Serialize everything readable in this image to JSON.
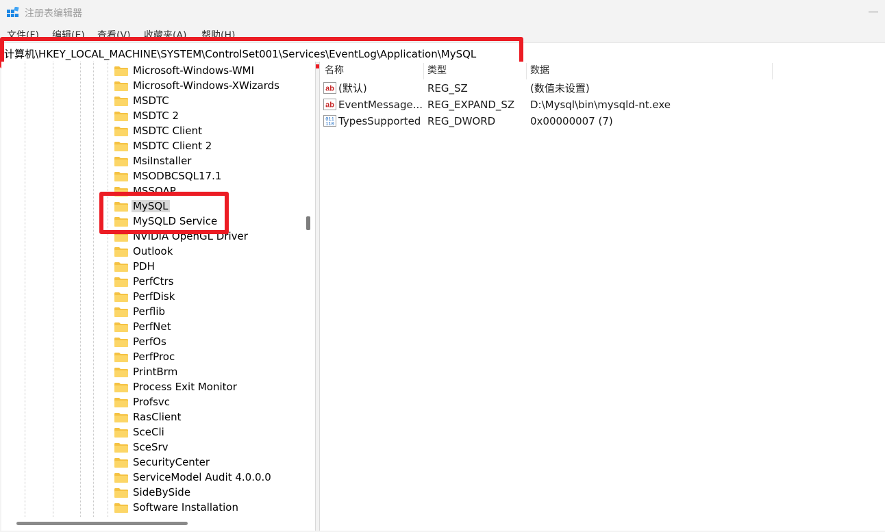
{
  "window": {
    "title": "注册表编辑器"
  },
  "menu": [
    "文件(F)",
    "编辑(E)",
    "查看(V)",
    "收藏夹(A)",
    "帮助(H)"
  ],
  "address": "计算机\\HKEY_LOCAL_MACHINE\\SYSTEM\\ControlSet001\\Services\\EventLog\\Application\\MySQL",
  "tree": {
    "items": [
      "Microsoft-Windows-WMI",
      "Microsoft-Windows-XWizards",
      "MSDTC",
      "MSDTC 2",
      "MSDTC Client",
      "MSDTC Client 2",
      "MsiInstaller",
      "MSODBCSQL17.1",
      "MSSOAP",
      "MySQL",
      "MySQLD Service",
      "NVIDIA OpenGL Driver",
      "Outlook",
      "PDH",
      "PerfCtrs",
      "PerfDisk",
      "Perflib",
      "PerfNet",
      "PerfOs",
      "PerfProc",
      "PrintBrm",
      "Process Exit Monitor",
      "Profsvc",
      "RasClient",
      "SceCli",
      "SceSrv",
      "SecurityCenter",
      "ServiceModel Audit 4.0.0.0",
      "SideBySide",
      "Software Installation"
    ],
    "selected": "MySQL"
  },
  "columns": {
    "name": "名称",
    "type": "类型",
    "data": "数据"
  },
  "values": [
    {
      "icon": "string-value-icon",
      "name": "(默认)",
      "type": "REG_SZ",
      "data": "(数值未设置)"
    },
    {
      "icon": "string-value-icon",
      "name": "EventMessage...",
      "type": "REG_EXPAND_SZ",
      "data": "D:\\Mysql\\bin\\mysqld-nt.exe"
    },
    {
      "icon": "binary-value-icon",
      "name": "TypesSupported",
      "type": "REG_DWORD",
      "data": "0x00000007 (7)"
    }
  ],
  "colors": {
    "highlight": "#ec1c24",
    "folder": "#f5c242",
    "selection": "#d9d9d9"
  }
}
